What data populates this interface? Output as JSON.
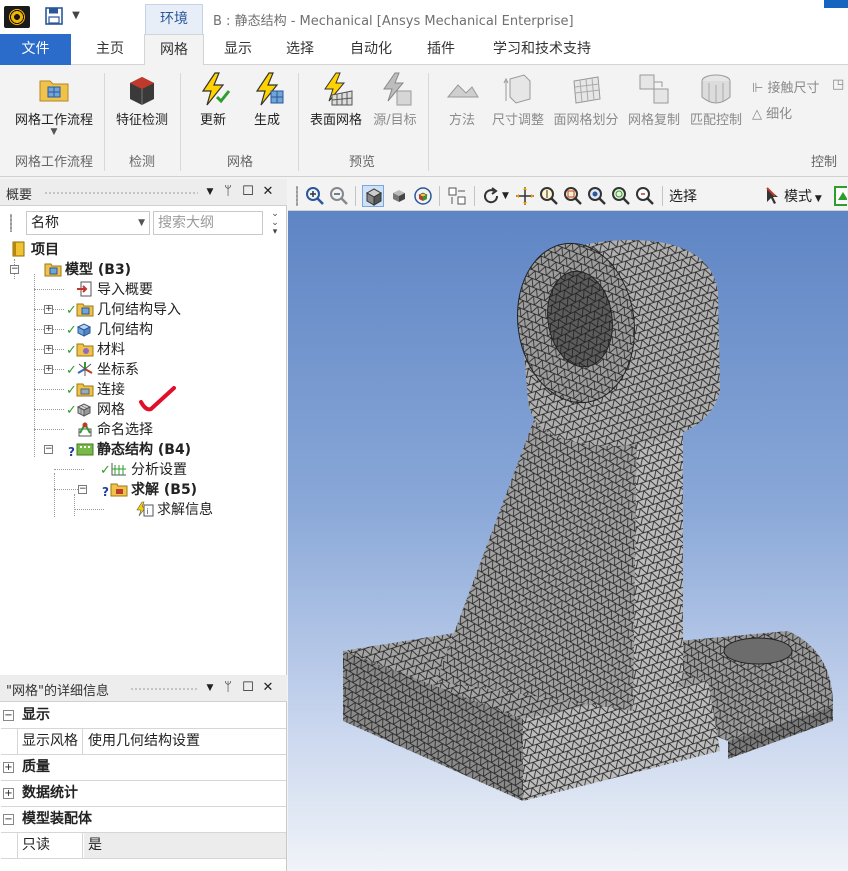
{
  "title_bar": {
    "context_tab": "环境",
    "window_title": "B : 静态结构 - Mechanical [Ansys Mechanical Enterprise]"
  },
  "ribbon_tabs": [
    "文件",
    "主页",
    "网格",
    "显示",
    "选择",
    "自动化",
    "插件",
    "学习和技术支持"
  ],
  "ribbon": {
    "buttons": {
      "mesh_workflow": "网格工作流程",
      "feature_detection": "特征检测",
      "update": "更新",
      "generate": "生成",
      "surface_mesh": "表面网格",
      "source_target": "源/目标",
      "method": "方法",
      "sizing": "尺寸调整",
      "face_meshing": "面网格划分",
      "mesh_copy": "网格复制",
      "match_control": "匹配控制",
      "contact_sizing": "接触尺寸",
      "refinement": "细化"
    },
    "groups": {
      "mesh_workflow": "网格工作流程",
      "detection": "检测",
      "mesh": "网格",
      "preview": "预览",
      "control": "控制"
    }
  },
  "outline": {
    "title": "概要",
    "name_combo": "名称",
    "search_placeholder": "搜索大纲",
    "tree": {
      "project": "项目",
      "model": "模型 (B3)",
      "import_summary": "导入概要",
      "geometry_import": "几何结构导入",
      "geometry": "几何结构",
      "materials": "材料",
      "coordinate_systems": "坐标系",
      "connections": "连接",
      "mesh": "网格",
      "named_selections": "命名选择",
      "static_structural": "静态结构 (B4)",
      "analysis_settings": "分析设置",
      "solution": "求解 (B5)",
      "solution_information": "求解信息"
    }
  },
  "details": {
    "title": "\"网格\"的详细信息",
    "groups": {
      "display": "显示",
      "quality": "质量",
      "statistics": "数据统计",
      "model_assembly": "模型装配体"
    },
    "rows": {
      "display_style_key": "显示风格",
      "display_style_value": "使用几何结构设置",
      "readonly_key": "只读",
      "readonly_value": "是"
    }
  },
  "graphics_toolbar": {
    "select_label": "选择",
    "mode_label": "模式"
  },
  "colors": {
    "file_tab": "#2b6bc9",
    "context_tab_text": "#2b579a",
    "check_green": "#2e9d2e",
    "annotation_red": "#e0102a",
    "viewport_top": "#5e85c4",
    "viewport_bottom": "#f0f3f8"
  }
}
